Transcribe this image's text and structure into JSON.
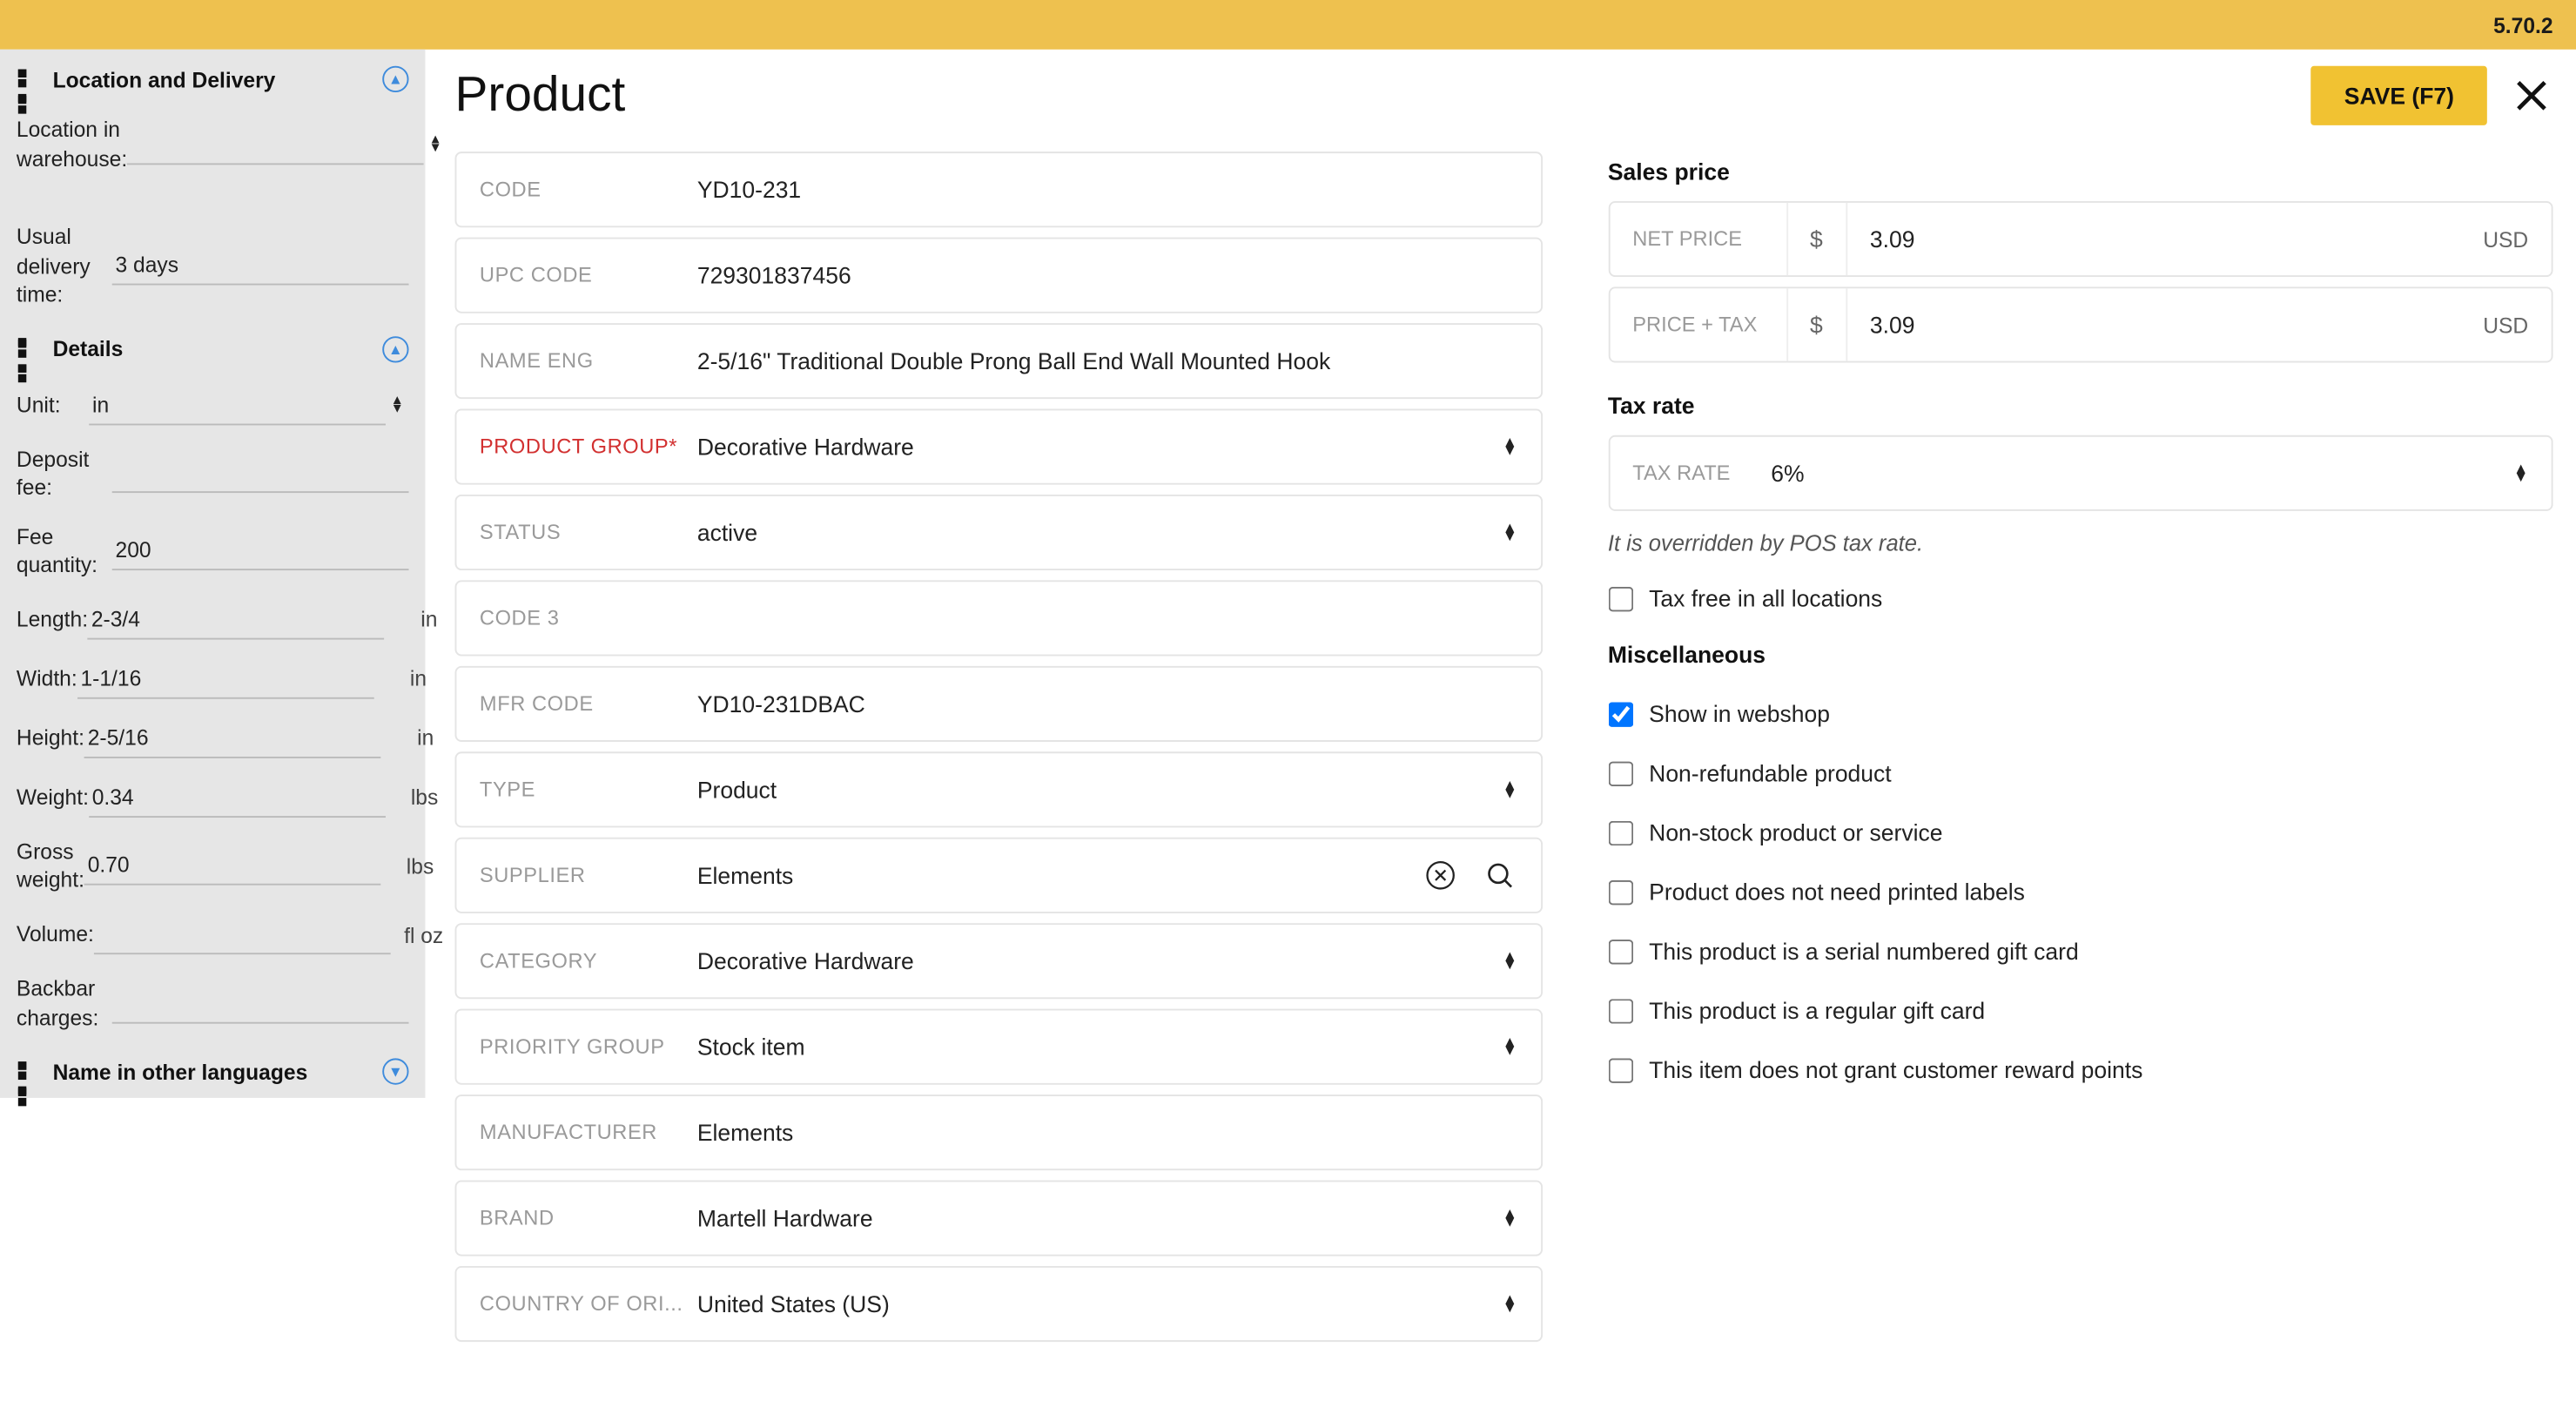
{
  "version": "5.70.2",
  "header": {
    "title": "Product",
    "save_label": "SAVE (F7)"
  },
  "sidebar": {
    "location_delivery": {
      "title": "Location and Delivery",
      "location_label": "Location in warehouse:",
      "location_value": "",
      "delivery_label": "Usual delivery time:",
      "delivery_value": "3 days"
    },
    "details": {
      "title": "Details",
      "unit_label": "Unit:",
      "unit_value": "in",
      "deposit_label": "Deposit fee:",
      "deposit_value": "",
      "fee_qty_label": "Fee quantity:",
      "fee_qty_value": "200",
      "length_label": "Length:",
      "length_value": "2-3/4",
      "length_unit": "in",
      "width_label": "Width:",
      "width_value": "1-1/16",
      "width_unit": "in",
      "height_label": "Height:",
      "height_value": "2-5/16",
      "height_unit": "in",
      "weight_label": "Weight:",
      "weight_value": "0.34",
      "weight_unit": "lbs",
      "gross_label": "Gross weight:",
      "gross_value": "0.70",
      "gross_unit": "lbs",
      "volume_label": "Volume:",
      "volume_value": "",
      "volume_unit": "fl oz",
      "backbar_label": "Backbar charges:",
      "backbar_value": ""
    },
    "other_lang": {
      "title": "Name in other languages"
    }
  },
  "form": {
    "code_label": "CODE",
    "code_value": "YD10-231",
    "upc_label": "UPC CODE",
    "upc_value": "729301837456",
    "name_label": "NAME ENG",
    "name_value": "2-5/16\" Traditional Double Prong Ball End Wall Mounted Hook",
    "group_label": "PRODUCT GROUP*",
    "group_value": "Decorative Hardware",
    "status_label": "STATUS",
    "status_value": "active",
    "code3_label": "CODE 3",
    "code3_value": "",
    "mfr_label": "MFR CODE",
    "mfr_value": "YD10-231DBAC",
    "type_label": "TYPE",
    "type_value": "Product",
    "supplier_label": "SUPPLIER",
    "supplier_value": "Elements",
    "category_label": "CATEGORY",
    "category_value": "Decorative Hardware",
    "priority_label": "PRIORITY GROUP",
    "priority_value": "Stock item",
    "manufacturer_label": "MANUFACTURER",
    "manufacturer_value": "Elements",
    "brand_label": "BRAND",
    "brand_value": "Martell Hardware",
    "country_label": "COUNTRY OF ORI...",
    "country_value": "United States (US)"
  },
  "right": {
    "sales_price_title": "Sales price",
    "net_label": "NET PRICE",
    "net_cur": "$",
    "net_value": "3.09",
    "net_suffix": "USD",
    "tax_price_label": "PRICE + TAX",
    "tax_price_cur": "$",
    "tax_price_value": "3.09",
    "tax_price_suffix": "USD",
    "tax_rate_title": "Tax rate",
    "tax_rate_label": "TAX RATE",
    "tax_rate_value": "6%",
    "tax_note": "It is overridden by POS tax rate.",
    "tax_free_label": "Tax free in all locations",
    "misc_title": "Miscellaneous",
    "show_webshop_label": "Show in webshop",
    "non_refund_label": "Non-refundable product",
    "non_stock_label": "Non-stock product or service",
    "no_labels_label": "Product does not need printed labels",
    "serial_gift_label": "This product is a serial numbered gift card",
    "regular_gift_label": "This product is a regular gift card",
    "no_reward_label": "This item does not grant customer reward points"
  }
}
